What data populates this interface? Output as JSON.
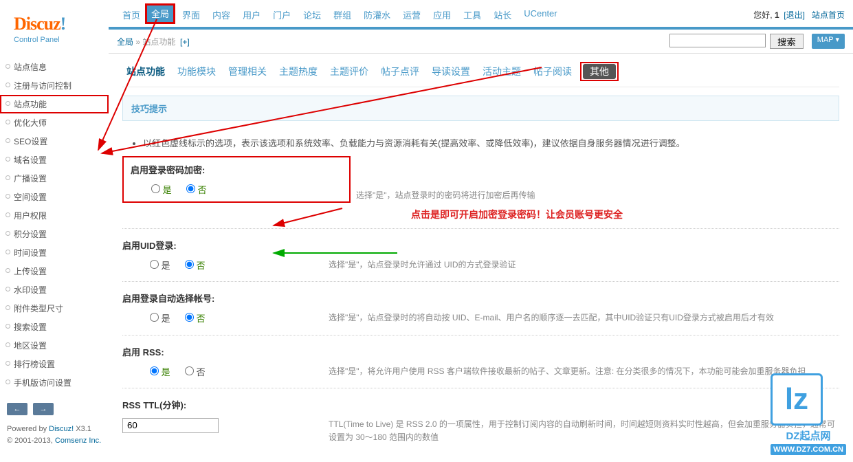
{
  "logo": {
    "brand": "Discuz",
    "punct": "!",
    "sub": "Control Panel"
  },
  "userinfo": {
    "greet": "您好, ",
    "user": "1",
    "logout": "[退出]",
    "home": "站点首页"
  },
  "topnav": [
    "首页",
    "全局",
    "界面",
    "内容",
    "用户",
    "门户",
    "论坛",
    "群组",
    "防灌水",
    "运营",
    "应用",
    "工具",
    "站长",
    "UCenter"
  ],
  "breadcrumb": {
    "a": "全局",
    "sep": " » ",
    "b": "站点功能",
    "plus": "[+]"
  },
  "search": {
    "btn": "搜索",
    "map": "MAP ▾"
  },
  "sidebar": [
    "站点信息",
    "注册与访问控制",
    "站点功能",
    "优化大师",
    "SEO设置",
    "域名设置",
    "广播设置",
    "空间设置",
    "用户权限",
    "积分设置",
    "时间设置",
    "上传设置",
    "水印设置",
    "附件类型尺寸",
    "搜索设置",
    "地区设置",
    "排行榜设置",
    "手机版访问设置"
  ],
  "tabs": [
    "站点功能",
    "功能模块",
    "管理相关",
    "主题热度",
    "主题评价",
    "帖子点评",
    "导读设置",
    "活动主题",
    "帖子阅读",
    "其他"
  ],
  "tip": {
    "title": "技巧提示",
    "body": "以红色虚线标示的选项，表示该选项和系统效率、负载能力与资源消耗有关(提高效率、或降低效率)，建议依据自身服务器情况进行调整。"
  },
  "yes": "是",
  "no": "否",
  "f1": {
    "label": "启用登录密码加密:",
    "desc": "选择\"是\"，站点登录时的密码将进行加密后再传输"
  },
  "note": "点击是即可开启加密登录密码！让会员账号更安全",
  "f2": {
    "label": "启用UID登录:",
    "desc": "选择\"是\"，站点登录时允许通过 UID的方式登录验证"
  },
  "f3": {
    "label": "启用登录自动选择帐号:",
    "desc": "选择\"是\"，站点登录时的将自动按 UID、E-mail、用户名的顺序逐一去匹配，其中UID验证只有UID登录方式被启用后才有效"
  },
  "f4": {
    "label": "启用 RSS:",
    "desc": "选择\"是\"，将允许用户使用 RSS 客户端软件接收最新的帖子、文章更新。注意: 在分类很多的情况下，本功能可能会加重服务器负担"
  },
  "f5": {
    "label": "RSS TTL(分钟):",
    "value": "60",
    "desc": "TTL(Time to Live) 是 RSS 2.0 的一项属性，用于控制订阅内容的自动刷新时间，时间越短则资料实时性越高，但会加重服务器负担，通常可设置为 30～180 范围内的数值"
  },
  "footer": {
    "l1a": "Powered by ",
    "l1b": "Discuz!",
    "l1c": " X3.1",
    "l2a": "© 2001-2013, ",
    "l2b": "Comsenz Inc."
  },
  "wm": {
    "logo": "lz",
    "name": "DZ起点网",
    "url": "WWW.DZ7.COM.CN"
  }
}
